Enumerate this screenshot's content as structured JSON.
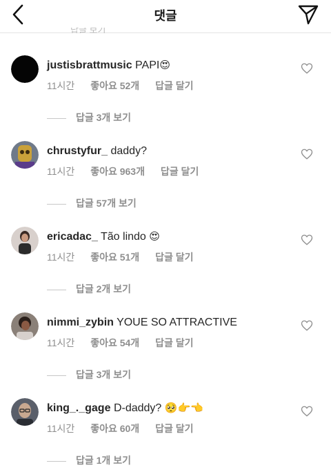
{
  "header": {
    "title": "댓글",
    "peek_text": "답글 보기",
    "back_icon": "chevron-left-icon",
    "send_icon": "paper-plane-icon"
  },
  "comments": [
    {
      "username": "justisbrattmusic",
      "text": "PAPI",
      "emoji": "😍",
      "time": "11시간",
      "likes": "좋아요 52개",
      "reply": "답글 달기",
      "view_replies": "답글 3개 보기",
      "avatar_color": "#050505"
    },
    {
      "username": "chrustyfur_",
      "text": "daddy?",
      "emoji": "",
      "time": "11시간",
      "likes": "좋아요 963개",
      "reply": "답글 달기",
      "view_replies": "답글 57개 보기",
      "avatar_color": "#7a6a3c"
    },
    {
      "username": "ericadac_",
      "text": "Tão lindo",
      "emoji": "😍",
      "time": "11시간",
      "likes": "좋아요 51개",
      "reply": "답글 달기",
      "view_replies": "답글 2개 보기",
      "avatar_color": "#c9bdb8"
    },
    {
      "username": "nimmi_zybin",
      "text": "YOUE SO ATTRACTIVE",
      "emoji": "",
      "time": "11시간",
      "likes": "좋아요 54개",
      "reply": "답글 달기",
      "view_replies": "답글 3개 보기",
      "avatar_color": "#4a3f3a"
    },
    {
      "username": "king_._gage",
      "text": "D-daddy?",
      "emoji": "🥺👉👈",
      "time": "11시간",
      "likes": "좋아요 60개",
      "reply": "답글 달기",
      "view_replies": "답글 1개 보기",
      "avatar_color": "#3b3f4a"
    }
  ]
}
